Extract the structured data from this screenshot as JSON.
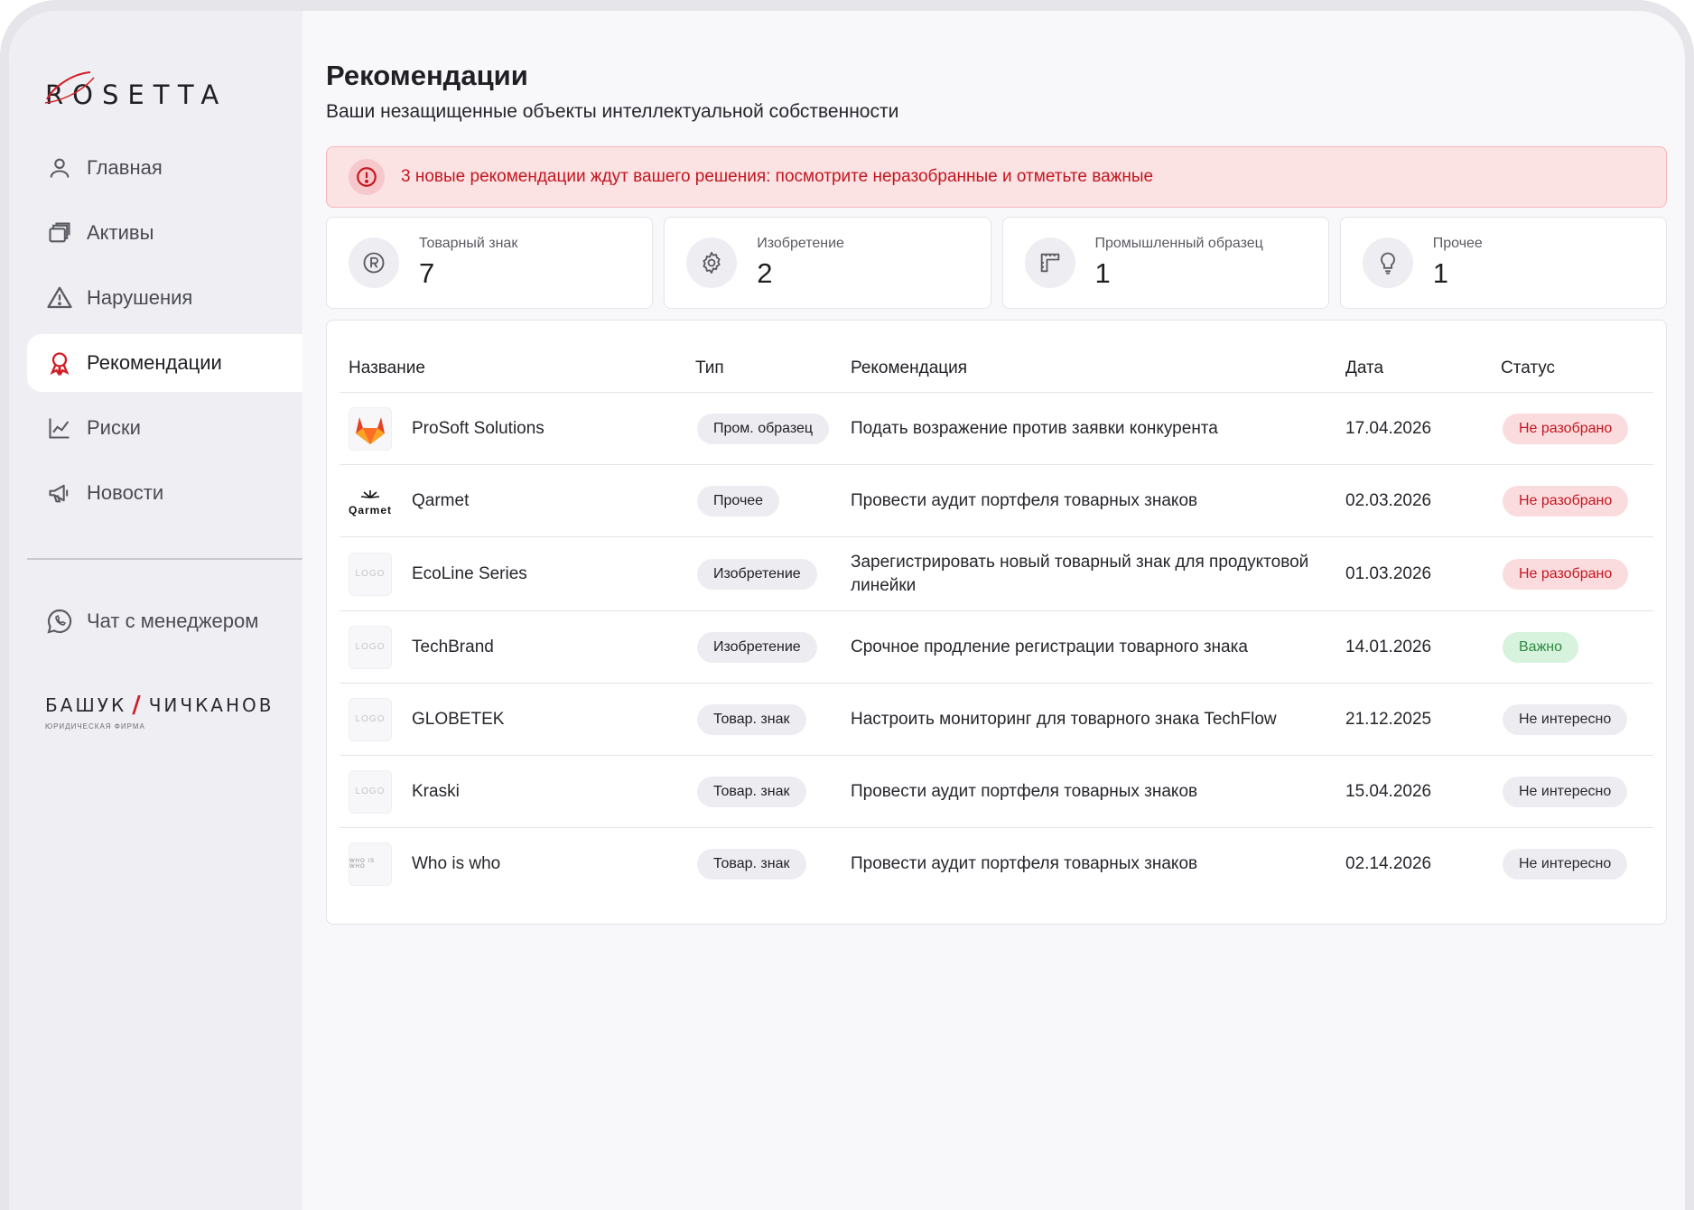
{
  "brand": {
    "logo_text": "OSETTA",
    "logo_initial": "R"
  },
  "sidebar": {
    "items": [
      {
        "label": "Главная",
        "icon": "user-icon"
      },
      {
        "label": "Активы",
        "icon": "stack-icon"
      },
      {
        "label": "Нарушения",
        "icon": "warning-icon"
      },
      {
        "label": "Рекомендации",
        "icon": "award-icon",
        "active": true
      },
      {
        "label": "Риски",
        "icon": "chart-icon"
      },
      {
        "label": "Новости",
        "icon": "megaphone-icon"
      }
    ],
    "chat_label": "Чат с менеджером",
    "firm": {
      "left": "БАШУК",
      "right": "ЧИЧКАНОВ",
      "subtitle": "юридическая фирма"
    }
  },
  "page": {
    "title": "Рекомендации",
    "subtitle": "Ваши незащищенные объекты интеллектуальной собственности"
  },
  "alert": {
    "text": "3 новые рекомендации ждут вашего решения: посмотрите неразобранные и отметьте важные"
  },
  "stats": [
    {
      "label": "Товарный знак",
      "value": "7",
      "icon": "registered-icon"
    },
    {
      "label": "Изобретение",
      "value": "2",
      "icon": "gear-icon"
    },
    {
      "label": "Промышленный образец",
      "value": "1",
      "icon": "ruler-icon"
    },
    {
      "label": "Прочее",
      "value": "1",
      "icon": "lightbulb-icon"
    }
  ],
  "table": {
    "headers": {
      "name": "Название",
      "type": "Тип",
      "recommendation": "Рекомендация",
      "date": "Дата",
      "status": "Статус"
    },
    "rows": [
      {
        "name": "ProSoft Solutions",
        "logo": "gitlab",
        "logo_text": "",
        "type": "Пром. образец",
        "recommendation": "Подать возражение против заявки конкурента",
        "date": "17.04.2026",
        "status": "Не разобрано",
        "status_kind": "red"
      },
      {
        "name": "Qarmet",
        "logo": "qarmet",
        "logo_text": "Qarmet",
        "type": "Прочее",
        "recommendation": "Провести аудит портфеля товарных знаков",
        "date": "02.03.2026",
        "status": "Не разобрано",
        "status_kind": "red"
      },
      {
        "name": "EcoLine Series",
        "logo": "placeholder",
        "logo_text": "LOGO",
        "type": "Изобретение",
        "recommendation": "Зарегистрировать новый товарный знак для продуктовой линейки",
        "date": "01.03.2026",
        "status": "Не разобрано",
        "status_kind": "red"
      },
      {
        "name": "TechBrand",
        "logo": "placeholder",
        "logo_text": "LOGO",
        "type": "Изобретение",
        "recommendation": "Срочное продление регистрации товарного знака",
        "date": "14.01.2026",
        "status": "Важно",
        "status_kind": "green"
      },
      {
        "name": "GLOBETEK",
        "logo": "placeholder",
        "logo_text": "LOGO",
        "type": "Товар. знак",
        "recommendation": "Настроить мониторинг для товарного знака TechFlow",
        "date": "21.12.2025",
        "status": "Не интересно",
        "status_kind": "gray"
      },
      {
        "name": "Kraski",
        "logo": "placeholder",
        "logo_text": "LOGO",
        "type": "Товар. знак",
        "recommendation": "Провести аудит портфеля товарных знаков",
        "date": "15.04.2026",
        "status": "Не интересно",
        "status_kind": "gray"
      },
      {
        "name": "Who is who",
        "logo": "placeholder",
        "logo_text": "WHO IS WHO",
        "type": "Товар. знак",
        "recommendation": "Провести аудит портфеля товарных знаков",
        "date": "02.14.2026",
        "status": "Не интересно",
        "status_kind": "gray"
      }
    ]
  },
  "colors": {
    "accent": "#d21d26",
    "alert_bg": "#fbe2e3",
    "alert_text": "#c4161f",
    "ok_bg": "#d7f2dd",
    "ok_text": "#2c8a3f"
  }
}
